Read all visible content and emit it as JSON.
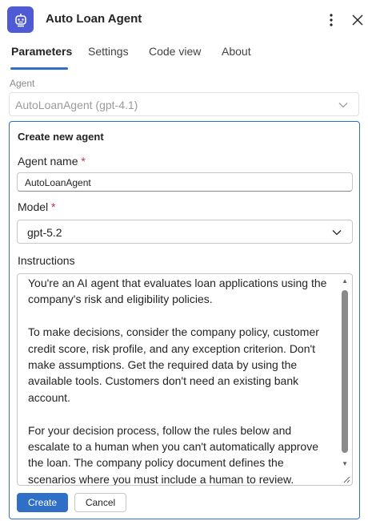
{
  "header": {
    "title": "Auto Loan Agent",
    "app_icon": "robot-icon",
    "more_icon": "more-vertical-icon",
    "close_icon": "close-icon"
  },
  "tabs": [
    {
      "label": "Parameters",
      "active": true
    },
    {
      "label": "Settings",
      "active": false
    },
    {
      "label": "Code view",
      "active": false
    },
    {
      "label": "About",
      "active": false
    }
  ],
  "agent": {
    "label": "Agent",
    "selected": "AutoLoanAgent (gpt-4.1)",
    "disabled": true
  },
  "create_panel": {
    "title": "Create new agent",
    "agent_name": {
      "label": "Agent name",
      "required_mark": "*",
      "value": "AutoLoanAgent"
    },
    "model": {
      "label": "Model",
      "required_mark": "*",
      "value": "gpt-5.2"
    },
    "instructions": {
      "label": "Instructions",
      "value": "You're an AI agent that evaluates loan applications using the company's risk and eligibility policies.\n\nTo make decisions, consider the company policy, customer credit score, risk profile, and any exception criterion. Don't make assumptions. Get the required data by using the available tools. Customers don't need an existing bank account.\n\nFor your decision process, follow the rules below and escalate to a human when you can't automatically approve the loan. The company policy document defines the scenarios where you must include a human to review."
    },
    "create_label": "Create",
    "cancel_label": "Cancel"
  },
  "colors": {
    "accent": "#2f6fc6",
    "app_icon_bg": "#4f5bd5",
    "required": "#c4314b"
  }
}
